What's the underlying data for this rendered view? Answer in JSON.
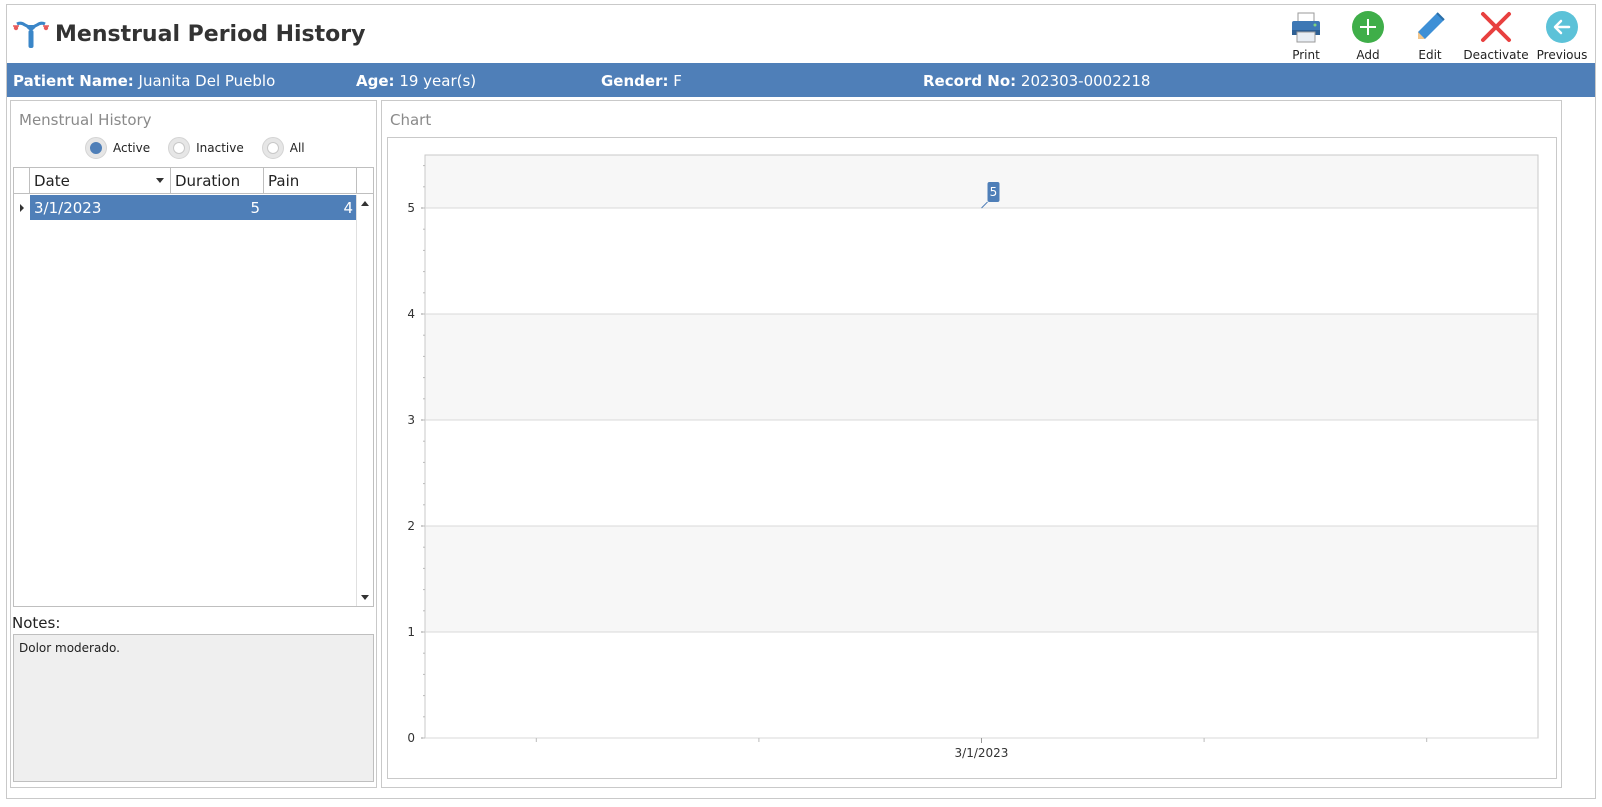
{
  "header": {
    "title": "Menstrual Period History",
    "toolbar": [
      {
        "label": "Print",
        "icon": "printer-icon"
      },
      {
        "label": "Add",
        "icon": "add-icon"
      },
      {
        "label": "Edit",
        "icon": "pencil-icon"
      },
      {
        "label": "Deactivate",
        "icon": "close-icon"
      },
      {
        "label": "Previous",
        "icon": "back-arrow-icon"
      }
    ]
  },
  "patient": {
    "name_label": "Patient Name:",
    "name": "Juanita Del Pueblo",
    "age_label": "Age:",
    "age": "19 year(s)",
    "gender_label": "Gender:",
    "gender": "F",
    "record_label": "Record No:",
    "record": "202303-0002218"
  },
  "history": {
    "caption": "Menstrual History",
    "filters": [
      {
        "label": "Active",
        "checked": true
      },
      {
        "label": "Inactive",
        "checked": false
      },
      {
        "label": "All",
        "checked": false
      }
    ],
    "columns": [
      "Date",
      "Duration",
      "Pain"
    ],
    "rows": [
      {
        "date": "3/1/2023",
        "duration": "5",
        "pain": "4"
      }
    ],
    "notes_label": "Notes:",
    "notes": "Dolor moderado."
  },
  "chart_panel": {
    "caption": "Chart"
  },
  "chart_data": {
    "type": "line",
    "categories": [
      "3/1/2023"
    ],
    "series": [
      {
        "values": [
          5
        ]
      }
    ],
    "data_labels": [
      "5"
    ],
    "ylim": [
      0,
      5.5
    ],
    "yticks": [
      0,
      1,
      2,
      3,
      4,
      5
    ],
    "grid": true,
    "colors": {
      "series": "#4f7fb8",
      "band": "#f7f7f7",
      "grid": "#d9d9d9"
    }
  },
  "colors": {
    "accent": "#4f7fb8"
  }
}
